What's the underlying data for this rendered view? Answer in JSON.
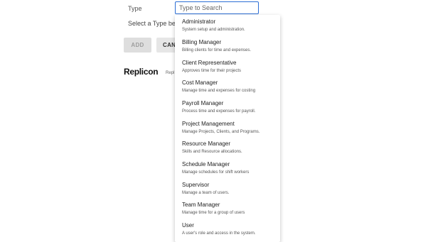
{
  "form": {
    "type_label": "Type",
    "select_prompt": "Select a Type befor",
    "search_placeholder": "Type to Search"
  },
  "buttons": {
    "add_label": "ADD",
    "cancel_label": "CANC"
  },
  "footer": {
    "logo": "Replicon",
    "text": "Repl"
  },
  "dropdown": {
    "options": [
      {
        "title": "Administrator",
        "desc": "System setup and administration."
      },
      {
        "title": "Billing Manager",
        "desc": "Billing clients for time and expenses."
      },
      {
        "title": "Client Representative",
        "desc": "Approves time for their projects"
      },
      {
        "title": "Cost Manager",
        "desc": "Manage time and expenses for costing"
      },
      {
        "title": "Payroll Manager",
        "desc": "Process time and expenses for payroll."
      },
      {
        "title": "Project Management",
        "desc": "Manage Projects, Clients, and Programs."
      },
      {
        "title": "Resource Manager",
        "desc": "Skills and Resource allocations."
      },
      {
        "title": "Schedule Manager",
        "desc": "Manage schedules for shift workers"
      },
      {
        "title": "Supervisor",
        "desc": "Manage a team of users."
      },
      {
        "title": "Team Manager",
        "desc": "Manage time for a group of users"
      },
      {
        "title": "User",
        "desc": "A user's role and access in the system."
      }
    ]
  }
}
